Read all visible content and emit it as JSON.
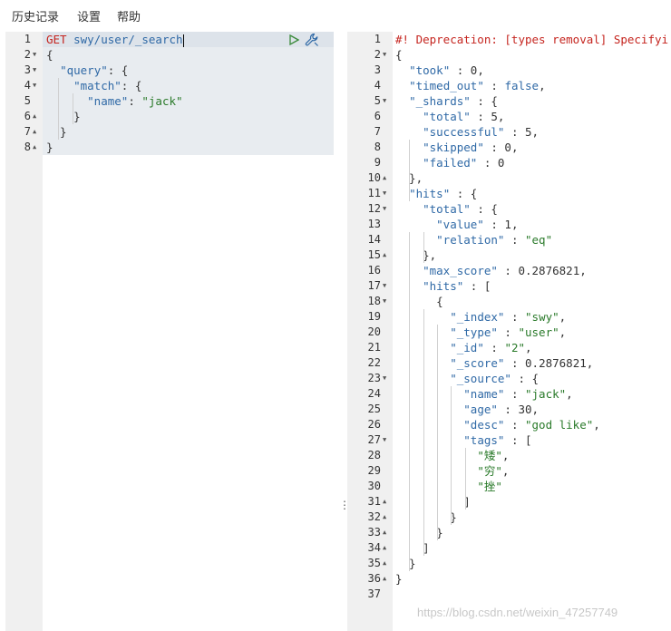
{
  "menu": {
    "history": "历史记录",
    "settings": "设置",
    "help": "帮助"
  },
  "request": {
    "method": "GET",
    "url": "swy/user/_search",
    "lines": [
      {
        "n": "1",
        "fold": ""
      },
      {
        "n": "2",
        "fold": "▼"
      },
      {
        "n": "3",
        "fold": "▼"
      },
      {
        "n": "4",
        "fold": "▼"
      },
      {
        "n": "5",
        "fold": ""
      },
      {
        "n": "6",
        "fold": "▲"
      },
      {
        "n": "7",
        "fold": "▲"
      },
      {
        "n": "8",
        "fold": "▲"
      }
    ],
    "body": {
      "open": "{",
      "query_key": "\"query\"",
      "match_key": "\"match\"",
      "name_key": "\"name\"",
      "name_value": "\"jack\""
    }
  },
  "response": {
    "deprecation": "#! Deprecation: [types removal] Specifyi",
    "line_numbers": [
      "1",
      "2",
      "3",
      "4",
      "5",
      "6",
      "7",
      "8",
      "9",
      "10",
      "11",
      "12",
      "13",
      "14",
      "15",
      "16",
      "17",
      "18",
      "19",
      "20",
      "21",
      "22",
      "23",
      "24",
      "25",
      "26",
      "27",
      "28",
      "29",
      "30",
      "31",
      "32",
      "33",
      "34",
      "35",
      "36",
      "37"
    ],
    "folds": [
      "",
      "▼",
      "",
      "",
      "▼",
      "",
      "",
      "",
      "",
      "▲",
      "▼",
      "▼",
      "",
      "",
      "▲",
      "",
      "▼",
      "▼",
      "",
      "",
      "",
      "",
      "▼",
      "",
      "",
      "",
      "▼",
      "",
      "",
      "",
      "▲",
      "▲",
      "▲",
      "▲",
      "▲",
      "▲",
      ""
    ],
    "took_key": "\"took\"",
    "took": "0",
    "timed_out_key": "\"timed_out\"",
    "timed_out": "false",
    "shards_key": "\"_shards\"",
    "total_key": "\"total\"",
    "shards_total": "5",
    "successful_key": "\"successful\"",
    "successful": "5",
    "skipped_key": "\"skipped\"",
    "skipped": "0",
    "failed_key": "\"failed\"",
    "failed": "0",
    "hits_key": "\"hits\"",
    "value_key": "\"value\"",
    "hits_value": "1",
    "relation_key": "\"relation\"",
    "relation": "\"eq\"",
    "max_score_key": "\"max_score\"",
    "max_score": "0.2876821",
    "index_key": "\"_index\"",
    "index": "\"swy\"",
    "type_key": "\"_type\"",
    "type": "\"user\"",
    "id_key": "\"_id\"",
    "id": "\"2\"",
    "score_key": "\"_score\"",
    "score": "0.2876821",
    "source_key": "\"_source\"",
    "name_key": "\"name\"",
    "name": "\"jack\"",
    "age_key": "\"age\"",
    "age": "30",
    "desc_key": "\"desc\"",
    "desc": "\"god like\"",
    "tags_key": "\"tags\"",
    "tags": [
      "\"矮\"",
      "\"穷\"",
      "\"挫\""
    ]
  },
  "splitter": {
    "handle": "⋮"
  },
  "watermark": "https://blog.csdn.net/weixin_47257749"
}
